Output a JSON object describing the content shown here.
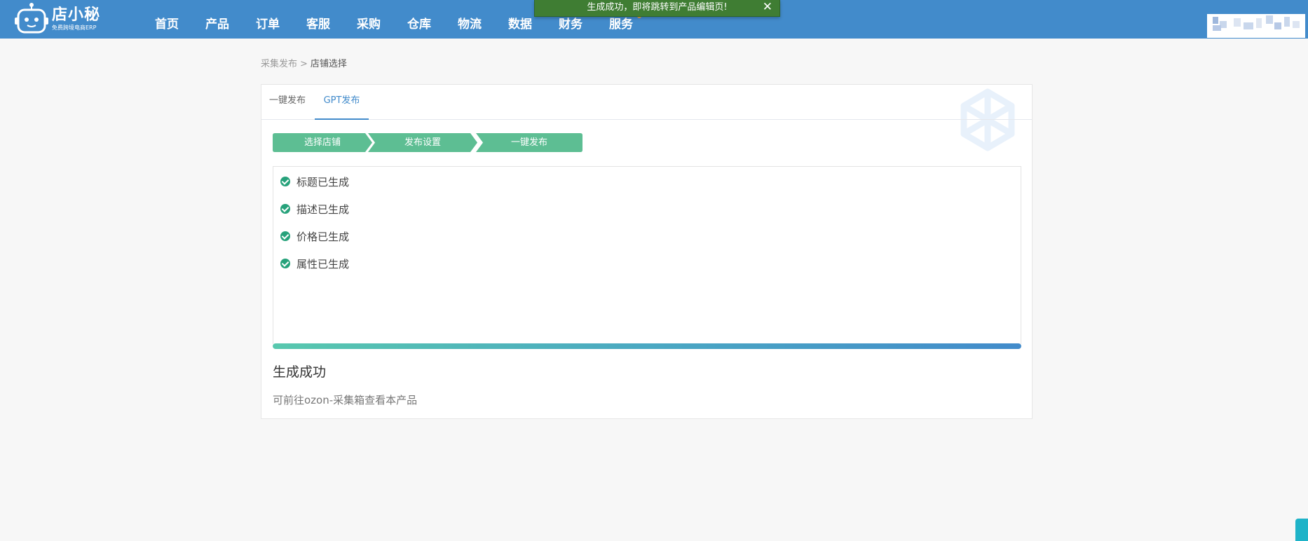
{
  "app": {
    "logo_name": "店小秘",
    "logo_sub": "免费跨境电商ERP"
  },
  "nav": {
    "items": [
      "首页",
      "产品",
      "订单",
      "客服",
      "采购",
      "仓库",
      "物流",
      "数据",
      "财务",
      "服务"
    ]
  },
  "toast": {
    "message": "生成成功，即将跳转到产品编辑页!",
    "close_glyph": "✕"
  },
  "breadcrumb": {
    "parent": "采集发布",
    "separator": ">",
    "current": "店铺选择"
  },
  "tabs": {
    "one_click": "一键发布",
    "gpt": "GPT发布",
    "active": "GPT发布"
  },
  "steps": [
    "选择店铺",
    "发布设置",
    "一键发布"
  ],
  "log": {
    "items": [
      "标题已生成",
      "描述已生成",
      "价格已生成",
      "属性已生成"
    ]
  },
  "progress": {
    "percent": 100
  },
  "result": {
    "title": "生成成功",
    "description": "可前往ozon-采集箱查看本产品"
  },
  "colors": {
    "header": "#428bcb",
    "toast": "#3f7d33",
    "step": "#5dbe93",
    "check": "#27a27b",
    "active_tab": "#428bcb"
  },
  "icons": {
    "logo": "robot-icon",
    "check": "check-circle-icon",
    "close": "close-icon",
    "watermark": "openai-icon"
  }
}
